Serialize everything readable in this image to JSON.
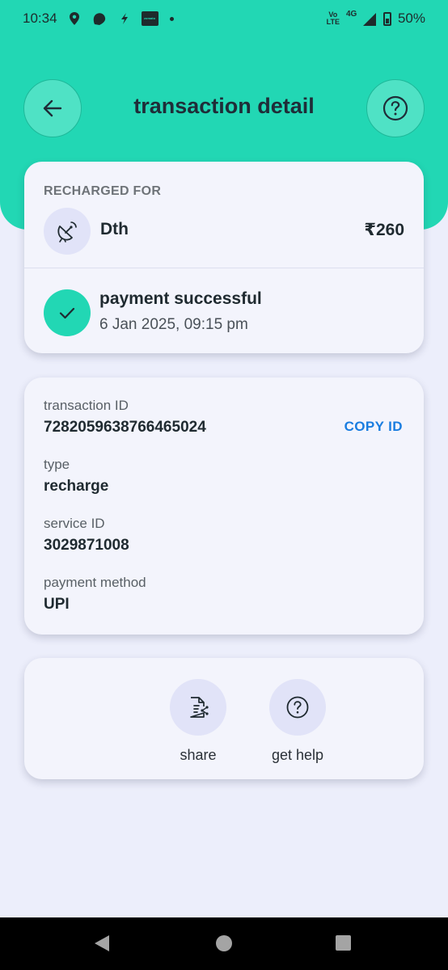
{
  "status_bar": {
    "time": "10:34",
    "notification_icons": [
      "location-pin-icon",
      "swiggy-icon",
      "bolt-icon",
      "zomato-icon",
      "dot-icon"
    ],
    "zomato_label": "zomato",
    "volte_top": "Vo",
    "volte_bottom": "LTE",
    "network": "4G",
    "battery": "50%"
  },
  "header": {
    "title": "transaction detail"
  },
  "recharge_card": {
    "section_label": "RECHARGED FOR",
    "service_name": "Dth",
    "amount": "₹260",
    "status": "payment successful",
    "datetime": "6 Jan 2025, 09:15 pm"
  },
  "details_card": {
    "transaction_id_label": "transaction ID",
    "transaction_id_value": "7282059638766465024",
    "copy_label": "COPY ID",
    "type_label": "type",
    "type_value": "recharge",
    "service_id_label": "service ID",
    "service_id_value": "3029871008",
    "payment_method_label": "payment method",
    "payment_method_value": "UPI"
  },
  "actions": {
    "share_label": "share",
    "help_label": "get help"
  },
  "colors": {
    "accent": "#22D7B4",
    "link": "#1A7DE0",
    "background": "#ECEEFB"
  }
}
